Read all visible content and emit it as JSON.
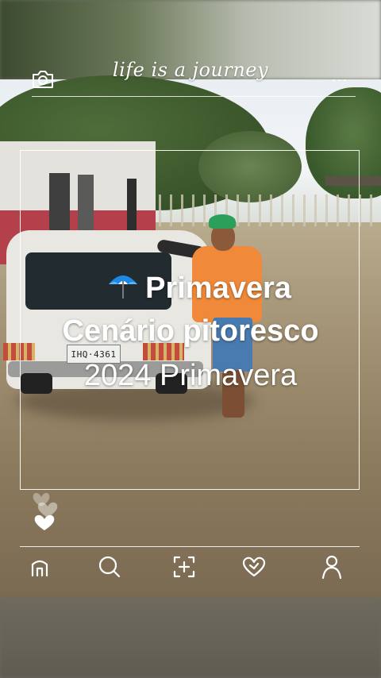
{
  "header": {
    "brand_title": "life is a journey",
    "camera_icon": "camera-icon",
    "more_icon": "more-horizontal-icon",
    "more_label": "···"
  },
  "photo": {
    "plate_text": "IHQ·4361"
  },
  "captions": {
    "line1": "Primavera",
    "line2": "Cenário pitoresco",
    "line3": "2024 Primavera"
  },
  "likes": {
    "icon": "heart-icon"
  },
  "bottom_nav": [
    {
      "icon": "home-icon"
    },
    {
      "icon": "search-icon"
    },
    {
      "icon": "add-photo-icon"
    },
    {
      "icon": "heart-icon"
    },
    {
      "icon": "profile-icon"
    }
  ],
  "colors": {
    "overlay": "#ffffff",
    "shirt": "#f08a3a",
    "cap": "#2aa05b",
    "umbrella_blue": "#1e88e5"
  }
}
